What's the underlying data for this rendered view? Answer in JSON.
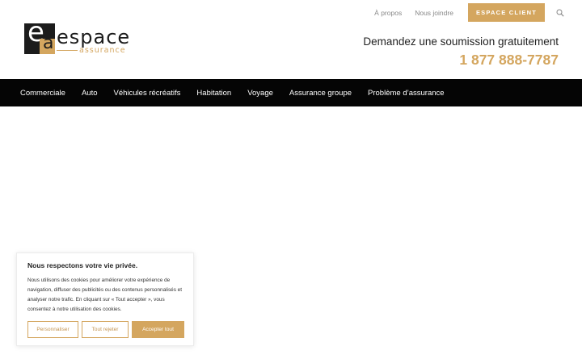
{
  "header": {
    "top_links": [
      "À propos",
      "Nous joindre"
    ],
    "client_button": "ESPACE CLIENT",
    "logo": {
      "word": "espace",
      "sub": "assurance",
      "mark_e": "e",
      "mark_a": "a"
    },
    "tagline": "Demandez une soumission gratuitement",
    "phone": "1 877 888-7787"
  },
  "nav": {
    "items": [
      "Commerciale",
      "Auto",
      "Véhicules récréatifs",
      "Habitation",
      "Voyage",
      "Assurance groupe",
      "Problème d’assurance"
    ]
  },
  "cookie": {
    "title": "Nous respectons votre vie privée.",
    "text": "Nous utilisons des cookies pour améliorer votre expérience de navigation, diffuser des publicités ou des contenus personnalisés et analyser notre trafic. En cliquant sur « Tout accepter », vous consentez à notre utilisation des cookies.",
    "buttons": {
      "customize": "Personnaliser",
      "reject": "Tout rejeter",
      "accept": "Accepter tout"
    }
  },
  "colors": {
    "accent": "#d4a65f",
    "nav_bg": "#050505",
    "text_dark": "#222222"
  },
  "icons": {
    "search": "search-icon"
  }
}
